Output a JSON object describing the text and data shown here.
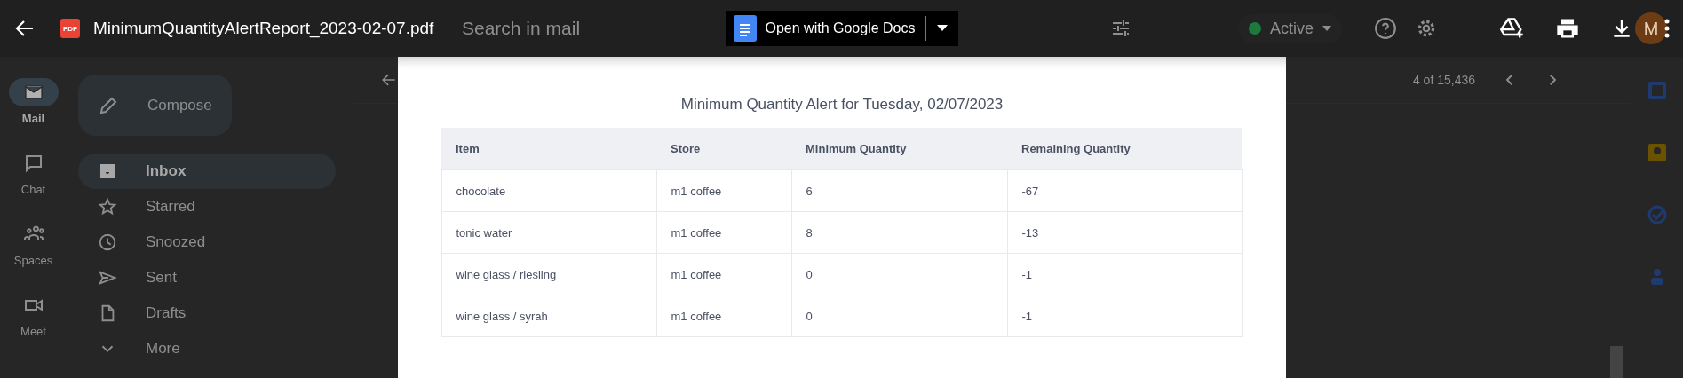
{
  "viewer": {
    "file_type": "PDF",
    "file_name": "MinimumQuantityAlertReport_2023-02-07.pdf",
    "open_with": "Open with Google Docs"
  },
  "document": {
    "title": "Minimum Quantity Alert for Tuesday, 02/07/2023",
    "table": {
      "columns": [
        "Item",
        "Store",
        "Minimum Quantity",
        "Remaining Quantity"
      ],
      "rows": [
        [
          "chocolate",
          "m1 coffee",
          "6",
          "-67"
        ],
        [
          "tonic water",
          "m1 coffee",
          "8",
          "-13"
        ],
        [
          "wine glass / riesling",
          "m1 coffee",
          "0",
          "-1"
        ],
        [
          "wine glass / syrah",
          "m1 coffee",
          "0",
          "-1"
        ]
      ]
    }
  },
  "mail_background": {
    "search": {
      "placeholder": "Search in mail"
    },
    "status": "Active",
    "avatar_initial": "M",
    "rail": [
      {
        "label": "Mail",
        "selected": true
      },
      {
        "label": "Chat",
        "selected": false
      },
      {
        "label": "Spaces",
        "selected": false
      },
      {
        "label": "Meet",
        "selected": false
      }
    ],
    "compose": "Compose",
    "nav": [
      {
        "label": "Inbox",
        "selected": true
      },
      {
        "label": "Starred",
        "selected": false
      },
      {
        "label": "Snoozed",
        "selected": false
      },
      {
        "label": "Sent",
        "selected": false
      },
      {
        "label": "Drafts",
        "selected": false
      },
      {
        "label": "More",
        "selected": false
      }
    ],
    "pager": "4 of 15,436"
  }
}
